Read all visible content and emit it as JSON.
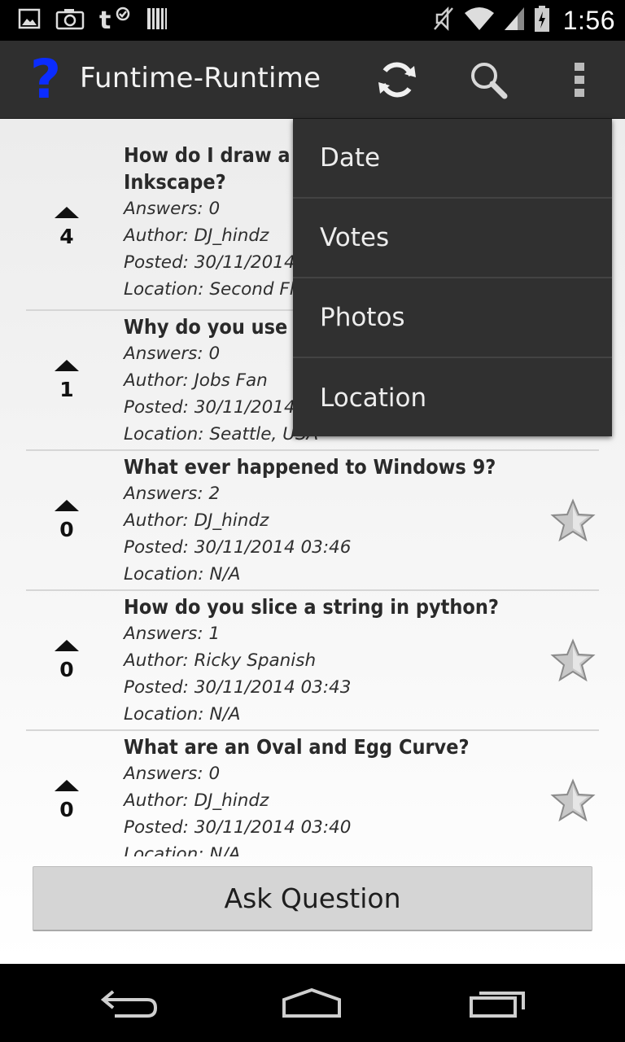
{
  "status_bar": {
    "time": "1:56",
    "left_icons": [
      "gallery-icon",
      "camera-icon",
      "t-mobile-icon",
      "barcode-icon"
    ],
    "right_icons": [
      "mute-icon",
      "wifi-icon",
      "signal-icon",
      "battery-icon"
    ]
  },
  "action_bar": {
    "app_icon_glyph": "?",
    "title": "Funtime-Runtime",
    "actions": [
      "refresh-icon",
      "search-icon",
      "overflow-menu-icon"
    ]
  },
  "questions": [
    {
      "votes": "4",
      "title_lines": [
        "How do I draw a",
        "Inkscape?"
      ],
      "answers": "Answers: 0",
      "author": "Author: DJ_hindz",
      "posted": "Posted: 30/11/2014",
      "location": "Location: Second Flo",
      "starred": false
    },
    {
      "votes": "1",
      "title_lines": [
        "Why do you use A"
      ],
      "answers": "Answers: 0",
      "author": "Author: Jobs Fan",
      "posted": "Posted: 30/11/2014",
      "location": "Location: Seattle, USA",
      "starred": false
    },
    {
      "votes": "0",
      "title_lines": [
        "What ever happened to Windows 9?"
      ],
      "answers": "Answers: 2",
      "author": "Author: DJ_hindz",
      "posted": "Posted: 30/11/2014  03:46",
      "location": "Location: N/A",
      "starred": true
    },
    {
      "votes": "0",
      "title_lines": [
        "How do you slice a string in python?"
      ],
      "answers": "Answers: 1",
      "author": "Author: Ricky Spanish",
      "posted": "Posted: 30/11/2014  03:43",
      "location": "Location: N/A",
      "starred": true
    },
    {
      "votes": "0",
      "title_lines": [
        "What are an Oval and Egg Curve?"
      ],
      "answers": "Answers: 0",
      "author": "Author: DJ_hindz",
      "posted": "Posted: 30/11/2014  03:40",
      "location": "Location: N/A",
      "starred": true
    }
  ],
  "ask_button": "Ask Question",
  "sort_menu": {
    "items": [
      "Date",
      "Votes",
      "Photos",
      "Location"
    ]
  },
  "nav_bar": {
    "buttons": [
      "back-icon",
      "home-icon",
      "recent-apps-icon"
    ]
  }
}
